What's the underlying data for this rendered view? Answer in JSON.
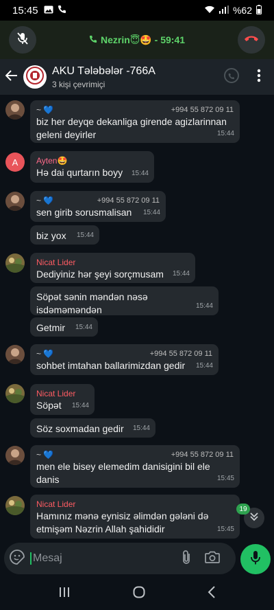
{
  "status": {
    "time": "15:45",
    "battery": "%62",
    "icons": [
      "image-icon",
      "phone-icon",
      "wifi-icon",
      "signal-icon",
      "battery-icon"
    ]
  },
  "call": {
    "caller": "Nezrin😇🤩 - 59:41",
    "accent": "#5ed46a"
  },
  "header": {
    "title": "AKU Tələbələr -766A",
    "subtitle": "3 kişi çevrimiçi"
  },
  "messages": [
    {
      "sender": "~ 💙",
      "phone": "+994 55 872 09 11",
      "text": "biz her deyqe dekanliga girende agizlarinnan geleni deyirler",
      "time": "15:44"
    },
    {
      "sender": "Ayten🤩",
      "avatar_letter": "A",
      "text": "Hə dai qurtarın boyy",
      "time": "15:44"
    },
    {
      "sender": "~ 💙",
      "phone": "+994 55 872 09 11",
      "text": "sen girib sorusmalisan",
      "time": "15:44"
    },
    {
      "text": "biz yox",
      "time": "15:44"
    },
    {
      "sender": "Nicat Lider",
      "text": "Dediyiniz hər şeyi sorçmusam",
      "time": "15:44"
    },
    {
      "text": "Söpət sənin məndən nəsə isdəməməndən",
      "time": "15:44"
    },
    {
      "text": "Getmir",
      "time": "15:44"
    },
    {
      "sender": "~ 💙",
      "phone": "+994 55 872 09 11",
      "text": "sohbet imtahan ballarimizdan gedir",
      "time": "15:44"
    },
    {
      "sender": "Nicat Lider",
      "text": "Söpət",
      "time": "15:44"
    },
    {
      "text": "Söz soxmadan gedir",
      "time": "15:44"
    },
    {
      "sender": "~ 💙",
      "phone": "+994 55 872 09 11",
      "text": "men ele bisey elemedim danisigini bil ele danis",
      "time": "15:45"
    },
    {
      "sender": "Nicat Lider",
      "text": "Hamınız mənə eynisiz əlimdən gələni də etmişəm Nəzrin Allah şahididir",
      "time": "15:45"
    }
  ],
  "unread_count": "19",
  "composer": {
    "placeholder": "Mesaj"
  }
}
